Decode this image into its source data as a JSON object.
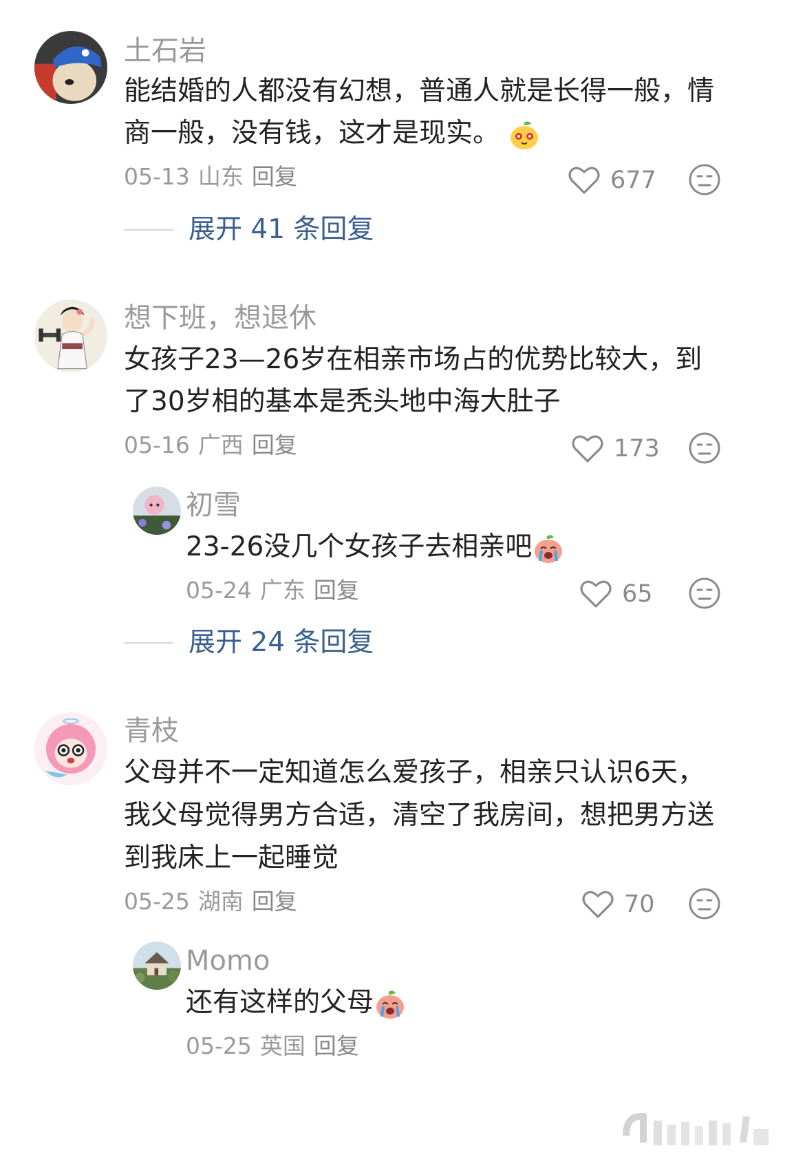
{
  "comments": [
    {
      "username": "土石岩",
      "text_lines": [
        "能结婚的人都没有幻想，普通人就是长得一般，情",
        "商一般，没有钱，这才是现实。"
      ],
      "date": "05-13",
      "location": "山东",
      "reply_label": "回复",
      "likes": "677",
      "expand_label": "展开 41 条回复",
      "avatar_icon": "dog-with-blue-cap-avatar"
    },
    {
      "username": "想下班，想退休",
      "text_lines": [
        "女孩子23—26岁在相亲市场占的优势比较大，到",
        "了30岁相的基本是秃头地中海大肚子"
      ],
      "date": "05-16",
      "location": "广西",
      "reply_label": "回复",
      "likes": "173",
      "avatar_icon": "girl-with-dumbbell-avatar",
      "reply": {
        "username": "初雪",
        "text": "23-26没几个女孩子去相亲吧",
        "date": "05-24",
        "location": "广东",
        "reply_label": "回复",
        "likes": "65",
        "avatar_icon": "flower-plush-avatar"
      },
      "expand_label": "展开 24 条回复"
    },
    {
      "username": "青枝",
      "text_lines": [
        "父母并不一定知道怎么爱孩子，相亲只认识6天，",
        "我父母觉得男方合适，清空了我房间，想把男方送",
        "到我床上一起睡觉"
      ],
      "date": "05-25",
      "location": "湖南",
      "reply_label": "回复",
      "likes": "70",
      "avatar_icon": "pink-anime-girl-avatar",
      "reply": {
        "username": "Momo",
        "text": "还有这样的父母",
        "date": "05-25",
        "location": "英国",
        "reply_label": "回复",
        "avatar_icon": "cottage-painting-avatar"
      }
    }
  ],
  "icons": {
    "like": "heart-outline-icon",
    "dislike": "dislike-face-icon",
    "emoji_smile": "peach-smile-emoji",
    "emoji_cry": "peach-crying-emoji"
  },
  "colors": {
    "username": "#9a9a9a",
    "text": "#222222",
    "meta": "#9a9a9a",
    "expand": "#3b5f8f"
  }
}
